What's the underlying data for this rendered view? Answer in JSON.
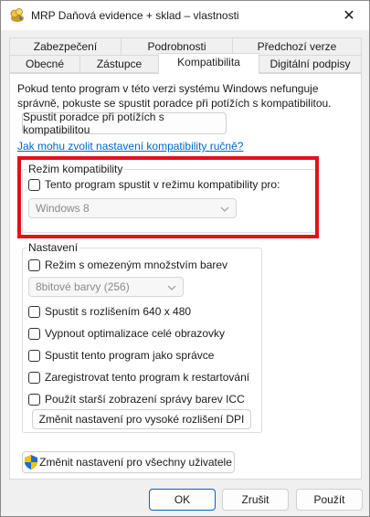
{
  "window": {
    "title": "MRP Daňová evidence + sklad – vlastnosti",
    "close_symbol": "✕",
    "icons": [
      "app-icon",
      "close-icon",
      "chevron-down-icon",
      "shield-icon"
    ],
    "colors": {
      "link": "#0066cc",
      "highlight": "#e3101a",
      "focus": "#0067c0"
    }
  },
  "tabs": {
    "row1": [
      "Zabezpečení",
      "Podrobnosti",
      "Předchozí verze"
    ],
    "row2": [
      "Obecné",
      "Zástupce",
      "Kompatibilita",
      "Digitální podpisy"
    ],
    "active": "Kompatibilita"
  },
  "compat": {
    "intro": "Pokud tento program v této verzi systému Windows nefunguje správně, pokuste se spustit poradce při potížích s kompatibilitou.",
    "troubleshooter_button": "Spustit poradce při potížích s kompatibilitou",
    "manual_link": "Jak mohu zvolit nastavení kompatibility ručně?",
    "mode_group": {
      "legend": "Režim kompatibility",
      "checkbox_label": "Tento program spustit v režimu kompatibility pro:",
      "os_select": "Windows 8"
    },
    "settings_group": {
      "legend": "Nastavení",
      "reduced_color": "Režim s omezeným množstvím barev",
      "color_select": "8bitové barvy (256)",
      "run_640": "Spustit s rozlišením 640 x 480",
      "disable_fullscreen": "Vypnout optimalizace celé obrazovky",
      "run_admin": "Spustit tento program jako správce",
      "register_restart": "Zaregistrovat tento program k restartování",
      "legacy_icc": "Použít starší zobrazení správy barev ICC",
      "dpi_button": "Změnit nastavení pro vysoké rozlišení DPI"
    },
    "all_users_button": "Změnit nastavení pro všechny uživatele"
  },
  "footer": {
    "ok": "OK",
    "cancel": "Zrušit",
    "apply": "Použít"
  }
}
